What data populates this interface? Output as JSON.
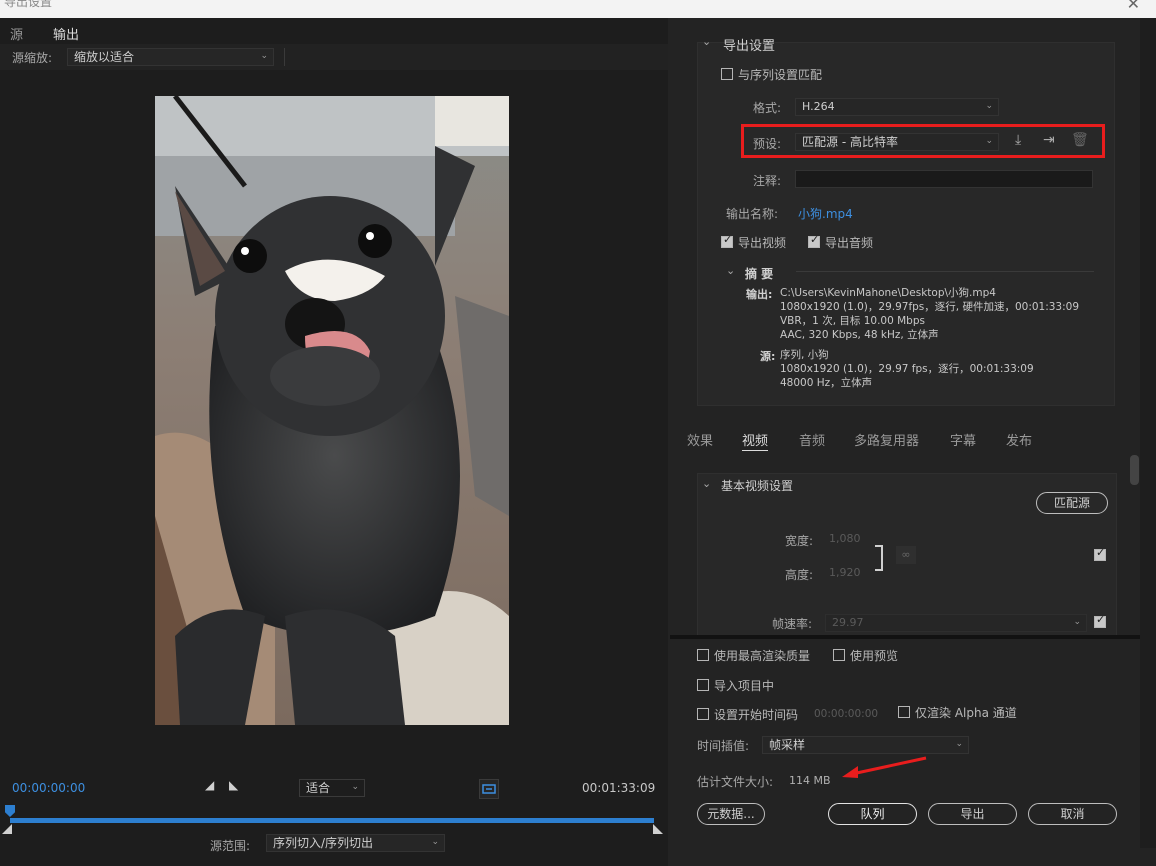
{
  "window": {
    "title": "导出设置",
    "close_glyph": "✕"
  },
  "left": {
    "tabs": [
      {
        "label": "源"
      },
      {
        "label": "输出"
      }
    ],
    "source_scale_label": "源缩放:",
    "source_scale_value": "缩放以适合",
    "timeline": {
      "current_tc": "00:00:00:00",
      "duration_tc": "00:01:33:09",
      "fit_value": "适合",
      "source_range_label": "源范围:",
      "source_range_value": "序列切入/序列切出"
    }
  },
  "export": {
    "section_title": "导出设置",
    "match_sequence": "与序列设置匹配",
    "format_label": "格式:",
    "format_value": "H.264",
    "preset_label": "预设:",
    "preset_value": "匹配源 - 高比特率",
    "comment_label": "注释:",
    "comment_value": "",
    "output_name_label": "输出名称:",
    "output_name_value": "小狗.mp4",
    "export_video": "导出视频",
    "export_audio": "导出音频",
    "summary": {
      "title": "摘 要",
      "output_label": "输出:",
      "output_lines": [
        "C:\\Users\\KevinMahone\\Desktop\\小狗.mp4",
        "1080x1920 (1.0)，29.97fps，逐行, 硬件加速，00:01:33:09",
        "VBR，1 次, 目标 10.00 Mbps",
        "AAC, 320 Kbps, 48 kHz, 立体声"
      ],
      "source_label": "源:",
      "source_lines": [
        "序列, 小狗",
        "1080x1920 (1.0)，29.97 fps，逐行，00:01:33:09",
        "48000 Hz，立体声"
      ]
    }
  },
  "tabs": [
    {
      "label": "效果"
    },
    {
      "label": "视频"
    },
    {
      "label": "音频"
    },
    {
      "label": "多路复用器"
    },
    {
      "label": "字幕"
    },
    {
      "label": "发布"
    }
  ],
  "video": {
    "section_title": "基本视频设置",
    "match_source_btn": "匹配源",
    "width_label": "宽度:",
    "width_value": "1,080",
    "height_label": "高度:",
    "height_value": "1,920",
    "fps_label": "帧速率:",
    "fps_value": "29.97"
  },
  "bottom": {
    "max_quality": "使用最高渲染质量",
    "use_preview": "使用预览",
    "import_project": "导入项目中",
    "set_start_tc": "设置开始时间码",
    "start_tc_value": "00:00:00:00",
    "alpha_only": "仅渲染 Alpha 通道",
    "time_interp_label": "时间插值:",
    "time_interp_value": "帧采样",
    "est_size_label": "估计文件大小:",
    "est_size_value": "114 MB",
    "metadata_btn": "元数据...",
    "queue_btn": "队列",
    "export_btn": "导出",
    "cancel_btn": "取消"
  },
  "colors": {
    "accent": "#3d8fe0",
    "highlight": "#e81d1d",
    "annotation_arrow": "#e81d1d"
  }
}
